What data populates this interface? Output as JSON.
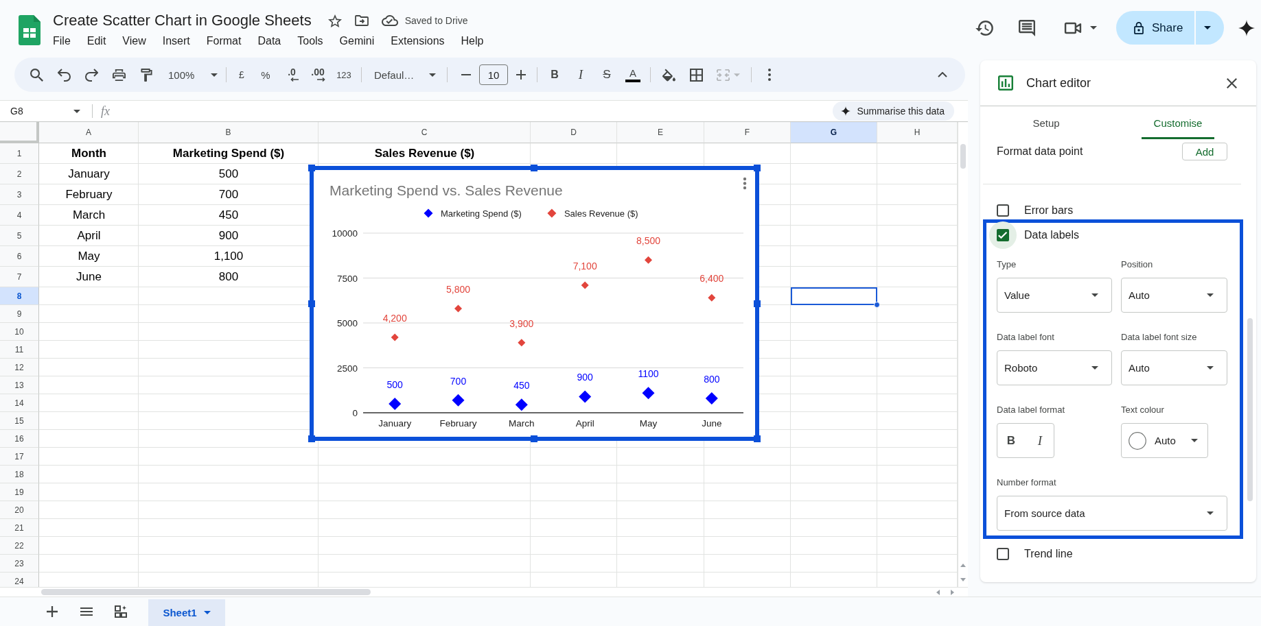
{
  "document": {
    "title": "Create Scatter Chart in Google Sheets",
    "save_status": "Saved to Drive"
  },
  "menu": [
    "File",
    "Edit",
    "View",
    "Insert",
    "Format",
    "Data",
    "Tools",
    "Gemini",
    "Extensions",
    "Help"
  ],
  "share": {
    "label": "Share"
  },
  "toolbar": {
    "zoom": "100%",
    "currency": "£",
    "percent": "%",
    "decrease_decimal": ".0",
    "increase_decimal": ".00",
    "number_format": "123",
    "font": "Defaul…",
    "font_size": "10",
    "bold": "B",
    "italic": "I",
    "strikethrough": "S",
    "text_colour": "A"
  },
  "formula_bar": {
    "cell_reference": "G8",
    "function_label": "fx",
    "summarise_button": "Summarise this data"
  },
  "grid": {
    "columns": [
      {
        "label": "A",
        "selected": false
      },
      {
        "label": "B",
        "selected": false
      },
      {
        "label": "C",
        "selected": false
      },
      {
        "label": "D",
        "selected": false
      },
      {
        "label": "E",
        "selected": false
      },
      {
        "label": "F",
        "selected": false
      },
      {
        "label": "G",
        "selected": true
      },
      {
        "label": "H",
        "selected": false
      }
    ],
    "rows": [
      {
        "label": "1",
        "selected": false,
        "cells": [
          "Month",
          "Marketing Spend ($)",
          "Sales Revenue ($)"
        ]
      },
      {
        "label": "2",
        "selected": false,
        "cells": [
          "January",
          "500"
        ]
      },
      {
        "label": "3",
        "selected": false,
        "cells": [
          "February",
          "700"
        ]
      },
      {
        "label": "4",
        "selected": false,
        "cells": [
          "March",
          "450"
        ]
      },
      {
        "label": "5",
        "selected": false,
        "cells": [
          "April",
          "900"
        ]
      },
      {
        "label": "6",
        "selected": false,
        "cells": [
          "May",
          "1,100"
        ]
      },
      {
        "label": "7",
        "selected": false,
        "cells": [
          "June",
          "800"
        ]
      },
      {
        "label": "8",
        "selected": true
      },
      {
        "label": "9",
        "selected": false
      },
      {
        "label": "10",
        "selected": false
      },
      {
        "label": "11",
        "selected": false
      },
      {
        "label": "12",
        "selected": false
      },
      {
        "label": "13",
        "selected": false
      },
      {
        "label": "14",
        "selected": false
      },
      {
        "label": "15",
        "selected": false
      },
      {
        "label": "16",
        "selected": false
      },
      {
        "label": "17",
        "selected": false
      },
      {
        "label": "18",
        "selected": false
      },
      {
        "label": "19",
        "selected": false
      },
      {
        "label": "20",
        "selected": false
      },
      {
        "label": "21",
        "selected": false
      },
      {
        "label": "22",
        "selected": false
      },
      {
        "label": "23",
        "selected": false
      },
      {
        "label": "24",
        "selected": false
      }
    ]
  },
  "chart": {
    "chart_data": {
      "type": "scatter",
      "title": "Marketing Spend vs. Sales Revenue",
      "categories": [
        "January",
        "February",
        "March",
        "April",
        "May",
        "June"
      ],
      "series": [
        {
          "name": "Marketing Spend ($)",
          "color": "#0000ff",
          "values": [
            500,
            700,
            450,
            900,
            1100,
            800
          ],
          "value_labels": [
            "500",
            "700",
            "450",
            "900",
            "1100",
            "800"
          ]
        },
        {
          "name": "Sales Revenue ($)",
          "color": "#e2453c",
          "values": [
            4200,
            5800,
            3900,
            7100,
            8500,
            6400
          ],
          "value_labels": [
            "4,200",
            "5,800",
            "3,900",
            "7,100",
            "8,500",
            "6,400"
          ]
        }
      ],
      "ylim": [
        0,
        10000
      ],
      "yticks": [
        0,
        2500,
        5000,
        7500,
        10000
      ],
      "grid": true,
      "legend": true,
      "data_labels": true
    }
  },
  "chart_editor": {
    "title": "Chart editor",
    "tabs": [
      {
        "label": "Setup",
        "selected": false
      },
      {
        "label": "Customise",
        "selected": true
      }
    ],
    "format_data_point": {
      "label": "Format data point",
      "button": "Add"
    },
    "series_options": [
      {
        "label": "Error bars",
        "checked": false,
        "focused": false,
        "highlighted": false
      },
      {
        "label": "Data labels",
        "checked": true,
        "focused": true,
        "highlighted": true,
        "settings": {
          "fields": [
            {
              "kind": "dropdown",
              "label": "Type",
              "value": "Value"
            },
            {
              "kind": "dropdown",
              "label": "Position",
              "value": "Auto"
            },
            {
              "kind": "dropdown",
              "label": "Data label font",
              "value": "Roboto"
            },
            {
              "kind": "dropdown",
              "label": "Data label font size",
              "value": "Auto"
            },
            {
              "kind": "format_buttons",
              "label": "Data label format",
              "buttons": [
                "B",
                "I"
              ]
            },
            {
              "kind": "colour",
              "label": "Text colour",
              "value": "Auto"
            }
          ],
          "number_format": {
            "label": "Number format",
            "value": "From source data"
          }
        }
      },
      {
        "label": "Trend line",
        "checked": false,
        "focused": false,
        "highlighted": false
      }
    ]
  },
  "sheet_tabs": [
    {
      "label": "Sheet1",
      "selected": true
    }
  ]
}
